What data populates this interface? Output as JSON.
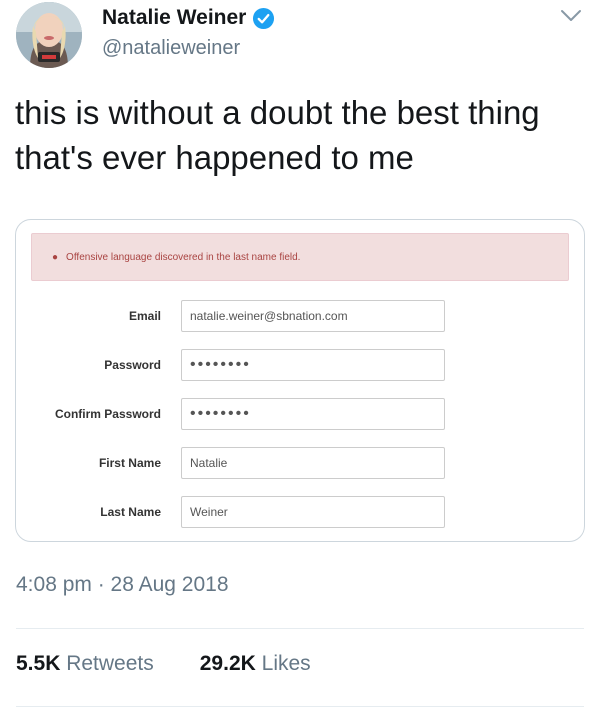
{
  "author": {
    "display_name": "Natalie Weiner",
    "handle": "@natalieweiner",
    "verified_icon": "verified-badge-icon",
    "verified_color": "#1da1f2"
  },
  "tweet": {
    "text_line1": "this is without a doubt the best thing",
    "text_line2": "that's ever happened to me"
  },
  "media": {
    "alert": {
      "message": "Offensive language discovered in the last name field."
    },
    "form": {
      "email_label": "Email",
      "email_value": "natalie.weiner@sbnation.com",
      "password_label": "Password",
      "password_value": "••••••••",
      "confirm_password_label": "Confirm Password",
      "confirm_password_value": "••••••••",
      "first_name_label": "First Name",
      "first_name_value": "Natalie",
      "last_name_label": "Last Name",
      "last_name_value": "Weiner"
    }
  },
  "footer": {
    "timestamp": "4:08 pm · 28 Aug 2018",
    "retweets_count": "5.5K",
    "retweets_label": "Retweets",
    "likes_count": "29.2K",
    "likes_label": "Likes"
  },
  "colors": {
    "text": "#14171a",
    "secondary": "#657786",
    "alert_bg": "#f2dede",
    "alert_text": "#a94442"
  }
}
